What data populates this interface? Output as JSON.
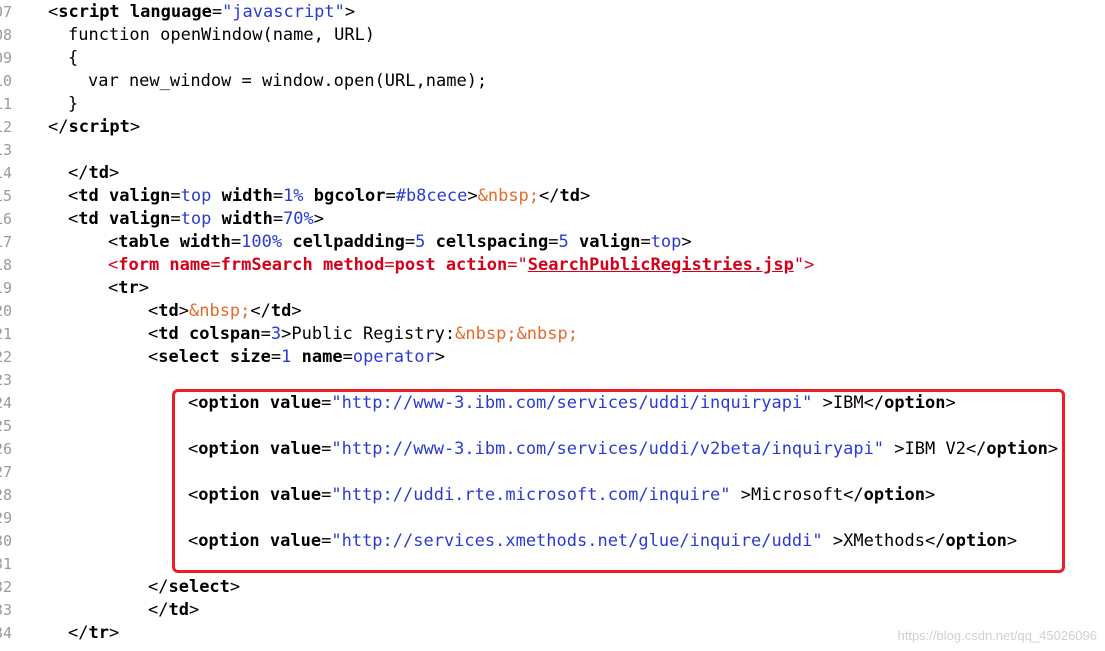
{
  "lines": [
    {
      "n": "07",
      "indent": 0,
      "parts": [
        [
          "br",
          "<"
        ],
        [
          "tag",
          "script"
        ],
        [
          "plain",
          " "
        ],
        [
          "attr",
          "language"
        ],
        [
          "plain",
          "="
        ],
        [
          "str",
          "\"javascript\""
        ],
        [
          "br",
          ">"
        ]
      ]
    },
    {
      "n": "08",
      "indent": 1,
      "parts": [
        [
          "plain",
          "function openWindow(name, URL)"
        ]
      ]
    },
    {
      "n": "09",
      "indent": 1,
      "parts": [
        [
          "plain",
          "{"
        ]
      ]
    },
    {
      "n": "10",
      "indent": 2,
      "parts": [
        [
          "plain",
          "var new_window = window.open(URL,name);"
        ]
      ]
    },
    {
      "n": "11",
      "indent": 1,
      "parts": [
        [
          "plain",
          "}"
        ]
      ]
    },
    {
      "n": "12",
      "indent": 0,
      "parts": [
        [
          "br",
          "</"
        ],
        [
          "tag",
          "script"
        ],
        [
          "br",
          ">"
        ]
      ]
    },
    {
      "n": "13",
      "indent": 0,
      "parts": []
    },
    {
      "n": "14",
      "indent": 1,
      "parts": [
        [
          "br",
          "</"
        ],
        [
          "tag",
          "td"
        ],
        [
          "br",
          ">"
        ]
      ]
    },
    {
      "n": "15",
      "indent": 1,
      "parts": [
        [
          "br",
          "<"
        ],
        [
          "tag",
          "td"
        ],
        [
          "plain",
          " "
        ],
        [
          "attr",
          "valign"
        ],
        [
          "plain",
          "="
        ],
        [
          "val",
          "top"
        ],
        [
          "plain",
          " "
        ],
        [
          "attr",
          "width"
        ],
        [
          "plain",
          "="
        ],
        [
          "val",
          "1%"
        ],
        [
          "plain",
          " "
        ],
        [
          "attr",
          "bgcolor"
        ],
        [
          "plain",
          "="
        ],
        [
          "val",
          "#b8cece"
        ],
        [
          "br",
          ">"
        ],
        [
          "ent",
          "&nbsp;"
        ],
        [
          "br",
          "</"
        ],
        [
          "tag",
          "td"
        ],
        [
          "br",
          ">"
        ]
      ]
    },
    {
      "n": "16",
      "indent": 1,
      "parts": [
        [
          "br",
          "<"
        ],
        [
          "tag",
          "td"
        ],
        [
          "plain",
          " "
        ],
        [
          "attr",
          "valign"
        ],
        [
          "plain",
          "="
        ],
        [
          "val",
          "top"
        ],
        [
          "plain",
          " "
        ],
        [
          "attr",
          "width"
        ],
        [
          "plain",
          "="
        ],
        [
          "val",
          "70%"
        ],
        [
          "br",
          ">"
        ]
      ]
    },
    {
      "n": "17",
      "indent": 3,
      "parts": [
        [
          "br",
          "<"
        ],
        [
          "tag",
          "table"
        ],
        [
          "plain",
          " "
        ],
        [
          "attr",
          "width"
        ],
        [
          "plain",
          "="
        ],
        [
          "val",
          "100%"
        ],
        [
          "plain",
          " "
        ],
        [
          "attr",
          "cellpadding"
        ],
        [
          "plain",
          "="
        ],
        [
          "val",
          "5"
        ],
        [
          "plain",
          " "
        ],
        [
          "attr",
          "cellspacing"
        ],
        [
          "plain",
          "="
        ],
        [
          "val",
          "5"
        ],
        [
          "plain",
          " "
        ],
        [
          "attr",
          "valign"
        ],
        [
          "plain",
          "="
        ],
        [
          "val",
          "top"
        ],
        [
          "br",
          ">"
        ]
      ]
    },
    {
      "n": "18",
      "indent": 3,
      "parts": [
        [
          "redp",
          "<"
        ],
        [
          "red",
          "form name"
        ],
        [
          "redp",
          "="
        ],
        [
          "red",
          "frmSearch method"
        ],
        [
          "redp",
          "="
        ],
        [
          "red",
          "post action"
        ],
        [
          "redp",
          "=\""
        ],
        [
          "redu",
          "SearchPublicRegistries.jsp"
        ],
        [
          "redp",
          "\">"
        ]
      ]
    },
    {
      "n": "19",
      "indent": 3,
      "parts": [
        [
          "br",
          "<"
        ],
        [
          "tag",
          "tr"
        ],
        [
          "br",
          ">"
        ]
      ]
    },
    {
      "n": "20",
      "indent": 5,
      "parts": [
        [
          "br",
          "<"
        ],
        [
          "tag",
          "td"
        ],
        [
          "br",
          ">"
        ],
        [
          "ent",
          "&nbsp;"
        ],
        [
          "br",
          "</"
        ],
        [
          "tag",
          "td"
        ],
        [
          "br",
          ">"
        ]
      ]
    },
    {
      "n": "21",
      "indent": 5,
      "parts": [
        [
          "br",
          "<"
        ],
        [
          "tag",
          "td"
        ],
        [
          "plain",
          " "
        ],
        [
          "attr",
          "colspan"
        ],
        [
          "plain",
          "="
        ],
        [
          "val",
          "3"
        ],
        [
          "br",
          ">"
        ],
        [
          "plain",
          "Public Registry:"
        ],
        [
          "ent",
          "&nbsp;&nbsp;"
        ]
      ]
    },
    {
      "n": "22",
      "indent": 5,
      "parts": [
        [
          "br",
          "<"
        ],
        [
          "tag",
          "select"
        ],
        [
          "plain",
          " "
        ],
        [
          "attr",
          "size"
        ],
        [
          "plain",
          "="
        ],
        [
          "val",
          "1"
        ],
        [
          "plain",
          " "
        ],
        [
          "attr",
          "name"
        ],
        [
          "plain",
          "="
        ],
        [
          "val",
          "operator"
        ],
        [
          "br",
          ">"
        ]
      ]
    },
    {
      "n": "23",
      "indent": 0,
      "parts": []
    },
    {
      "n": "24",
      "indent": 7,
      "parts": [
        [
          "br",
          "<"
        ],
        [
          "tag",
          "option"
        ],
        [
          "plain",
          " "
        ],
        [
          "attr",
          "value"
        ],
        [
          "plain",
          "="
        ],
        [
          "str",
          "\"http://www-3.ibm.com/services/uddi/inquiryapi\""
        ],
        [
          "plain",
          " >IBM"
        ],
        [
          "br",
          "</"
        ],
        [
          "tag",
          "option"
        ],
        [
          "br",
          ">"
        ]
      ]
    },
    {
      "n": "25",
      "indent": 0,
      "parts": []
    },
    {
      "n": "26",
      "indent": 7,
      "parts": [
        [
          "br",
          "<"
        ],
        [
          "tag",
          "option"
        ],
        [
          "plain",
          " "
        ],
        [
          "attr",
          "value"
        ],
        [
          "plain",
          "="
        ],
        [
          "str",
          "\"http://www-3.ibm.com/services/uddi/v2beta/inquiryapi\""
        ],
        [
          "plain",
          " >IBM V2"
        ],
        [
          "br",
          "</"
        ],
        [
          "tag",
          "option"
        ],
        [
          "br",
          ">"
        ]
      ]
    },
    {
      "n": "27",
      "indent": 0,
      "parts": []
    },
    {
      "n": "28",
      "indent": 7,
      "parts": [
        [
          "br",
          "<"
        ],
        [
          "tag",
          "option"
        ],
        [
          "plain",
          " "
        ],
        [
          "attr",
          "value"
        ],
        [
          "plain",
          "="
        ],
        [
          "str",
          "\"http://uddi.rte.microsoft.com/inquire\""
        ],
        [
          "plain",
          " >Microsoft"
        ],
        [
          "br",
          "</"
        ],
        [
          "tag",
          "option"
        ],
        [
          "br",
          ">"
        ]
      ]
    },
    {
      "n": "29",
      "indent": 0,
      "parts": []
    },
    {
      "n": "30",
      "indent": 7,
      "parts": [
        [
          "br",
          "<"
        ],
        [
          "tag",
          "option"
        ],
        [
          "plain",
          " "
        ],
        [
          "attr",
          "value"
        ],
        [
          "plain",
          "="
        ],
        [
          "str",
          "\"http://services.xmethods.net/glue/inquire/uddi\""
        ],
        [
          "plain",
          " >XMethods"
        ],
        [
          "br",
          "</"
        ],
        [
          "tag",
          "option"
        ],
        [
          "br",
          ">"
        ]
      ]
    },
    {
      "n": "31",
      "indent": 0,
      "parts": []
    },
    {
      "n": "32",
      "indent": 5,
      "parts": [
        [
          "br",
          "</"
        ],
        [
          "tag",
          "select"
        ],
        [
          "br",
          ">"
        ]
      ]
    },
    {
      "n": "33",
      "indent": 5,
      "parts": [
        [
          "br",
          "</"
        ],
        [
          "tag",
          "td"
        ],
        [
          "br",
          ">"
        ]
      ]
    },
    {
      "n": "34",
      "indent": 1,
      "parts": [
        [
          "br",
          "</"
        ],
        [
          "tag",
          "tr"
        ],
        [
          "br",
          ">"
        ]
      ]
    }
  ],
  "watermark": "https://blog.csdn.net/qq_45026096"
}
